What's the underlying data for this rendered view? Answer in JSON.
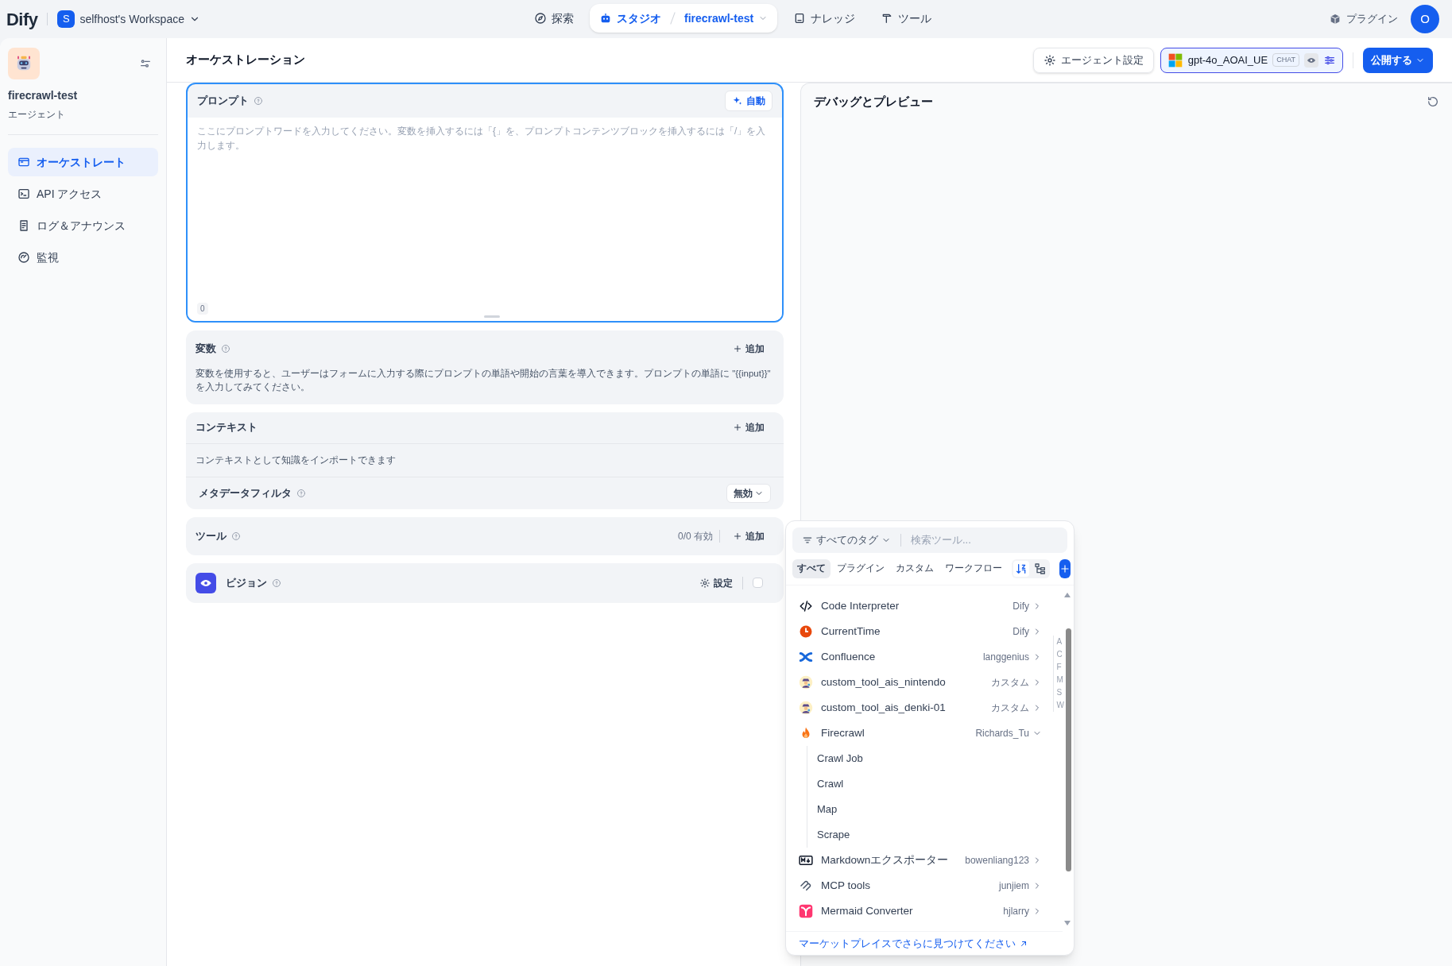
{
  "header": {
    "logo": "Dify",
    "workspace": {
      "initial": "S",
      "name": "selfhost's Workspace"
    },
    "nav": [
      {
        "label": "探索",
        "selected": false
      },
      {
        "label": "スタジオ",
        "selected": true,
        "app": "firecrawl-test"
      },
      {
        "label": "ナレッジ",
        "selected": false
      },
      {
        "label": "ツール",
        "selected": false
      }
    ],
    "plugins": "プラグイン",
    "avatar": "O"
  },
  "sidebar": {
    "app_name": "firecrawl-test",
    "app_type": "エージェント",
    "items": [
      {
        "label": "オーケストレート",
        "selected": true
      },
      {
        "label": "API アクセス",
        "selected": false
      },
      {
        "label": "ログ＆アナウンス",
        "selected": false
      },
      {
        "label": "監視",
        "selected": false
      }
    ]
  },
  "page_title": "オーケストレーション",
  "toolbar": {
    "agent_settings": "エージェント設定",
    "model": {
      "name": "gpt-4o_AOAI_UE",
      "badge": "CHAT"
    },
    "publish": "公開する"
  },
  "prompt": {
    "title": "プロンプト",
    "auto": "自動",
    "placeholder": "ここにプロンプトワードを入力してください。変数を挿入するには「{」を、プロンプトコンテンツブロックを挿入するには「/」を入力します。",
    "count": "0"
  },
  "variables": {
    "title": "変数",
    "add": "追加",
    "description": "変数を使用すると、ユーザーはフォームに入力する際にプロンプトの単語や開始の言葉を導入できます。プロンプトの単語に \"{{input}}\" を入力してみてください。"
  },
  "context": {
    "title": "コンテキスト",
    "add": "追加",
    "description": "コンテキストとして知識をインポートできます",
    "metadata_filter": {
      "label": "メタデータフィルタ",
      "value": "無効"
    }
  },
  "tools": {
    "title": "ツール",
    "count": "0/0 有効",
    "add": "追加"
  },
  "vision": {
    "title": "ビジョン",
    "settings": "設定",
    "checked": false
  },
  "debug": {
    "title": "デバッグとプレビュー"
  },
  "tool_picker": {
    "tag_filter": "すべてのタグ",
    "search_placeholder": "検索ツール...",
    "tabs": [
      {
        "label": "すべて",
        "selected": true
      },
      {
        "label": "プラグイン",
        "selected": false
      },
      {
        "label": "カスタム",
        "selected": false
      },
      {
        "label": "ワークフロー",
        "selected": false
      }
    ],
    "items": [
      {
        "name": "Code Interpreter",
        "source": "Dify",
        "expanded": false
      },
      {
        "name": "CurrentTime",
        "source": "Dify",
        "expanded": false
      },
      {
        "name": "Confluence",
        "source": "langgenius",
        "expanded": false
      },
      {
        "name": "custom_tool_ais_nintendo",
        "source": "カスタム",
        "expanded": false
      },
      {
        "name": "custom_tool_ais_denki-01",
        "source": "カスタム",
        "expanded": false
      },
      {
        "name": "Firecrawl",
        "source": "Richards_Tu",
        "expanded": true,
        "children": [
          "Crawl Job",
          "Crawl",
          "Map",
          "Scrape"
        ]
      },
      {
        "name": "Markdownエクスポーター",
        "source": "bowenliang123",
        "expanded": false
      },
      {
        "name": "MCP tools",
        "source": "junjiem",
        "expanded": false
      },
      {
        "name": "Mermaid Converter",
        "source": "hjlarry",
        "expanded": false
      }
    ],
    "index": [
      "A",
      "C",
      "F",
      "M",
      "S",
      "W"
    ],
    "marketplace_link": "マーケットプレイスでさらに見つけてください"
  }
}
